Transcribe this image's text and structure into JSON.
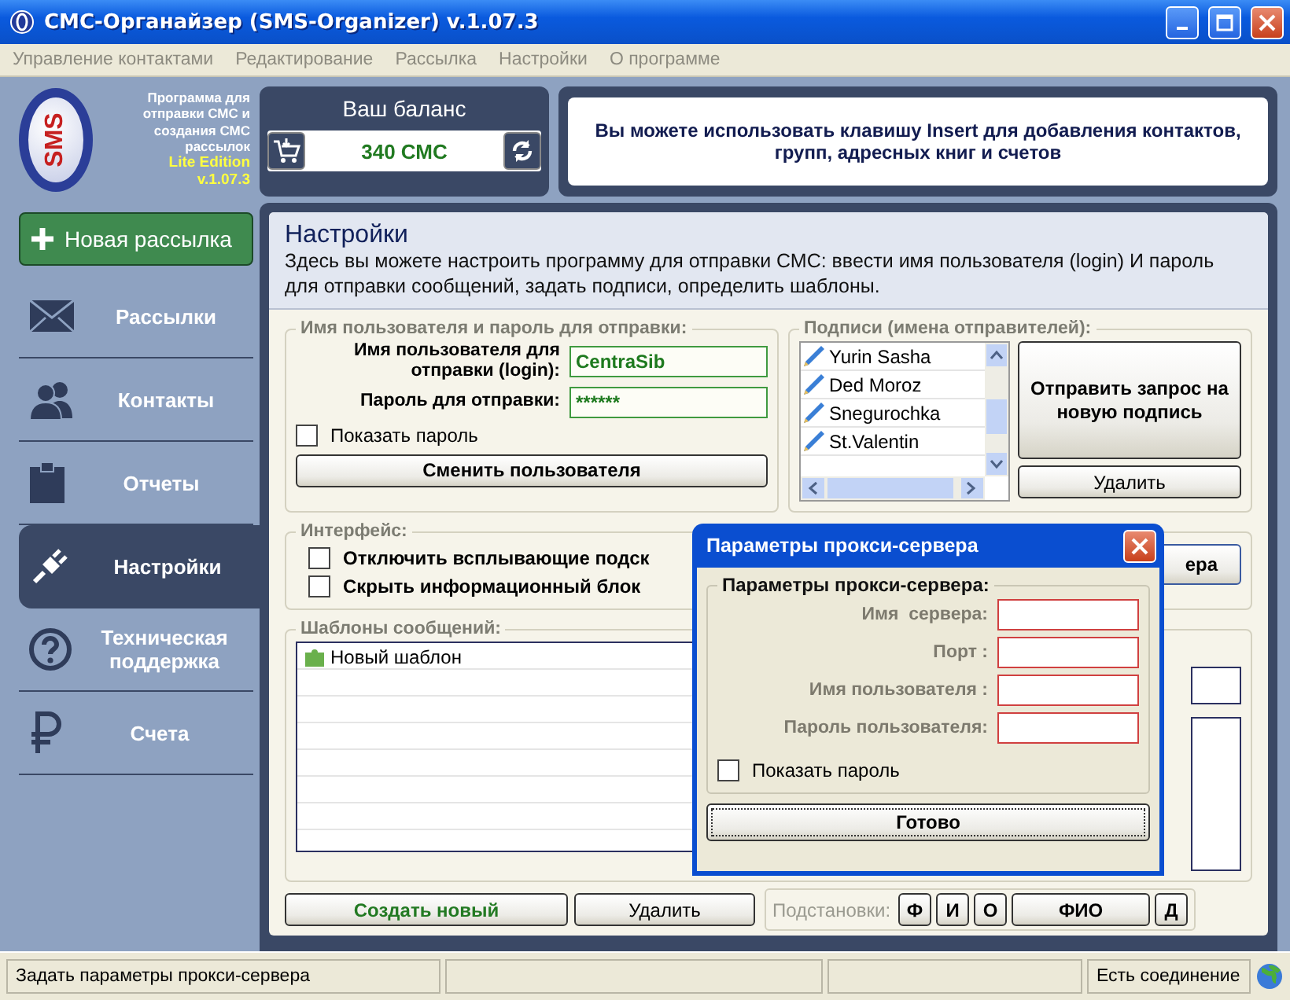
{
  "window": {
    "title": "СМС-Органайзер (SMS-Organizer) v.1.07.3"
  },
  "menu": [
    "Управление контактами",
    "Редактирование",
    "Рассылка",
    "Настройки",
    "О программе"
  ],
  "logo": {
    "mark": "SMS",
    "description": "Программа для отправки СМС и создания СМС рассылок",
    "edition": "Lite Edition",
    "version": "v.1.07.3"
  },
  "balance": {
    "title": "Ваш баланс",
    "value": "340 СМС"
  },
  "info": "Вы можете использовать клавишу Insert для добавления контактов, групп, адресных книг и счетов",
  "new_mailing": "Новая рассылка",
  "nav": [
    {
      "kind": "mail",
      "label": "Рассылки",
      "selected": false
    },
    {
      "kind": "contacts",
      "label": "Контакты",
      "selected": false
    },
    {
      "kind": "reports",
      "label": "Отчеты",
      "selected": false
    },
    {
      "kind": "settings",
      "label": "Настройки",
      "selected": true
    },
    {
      "kind": "support",
      "label": "Техническая поддержка",
      "selected": false
    },
    {
      "kind": "bills",
      "label": "Счета",
      "selected": false
    }
  ],
  "settings": {
    "title": "Настройки",
    "description": "Здесь вы можете настроить программу для отправки СМС: ввести имя пользователя (login) И пароль для отправки сообщений, задать подписи, определить шаблоны.",
    "credentials": {
      "legend": "Имя пользователя и пароль для отправки:",
      "login_label": "Имя пользователя для отправки (login):",
      "login": "CentraSib",
      "password_label": "Пароль для отправки:",
      "password": "******",
      "show_password": {
        "label": "Показать пароль",
        "checked": false
      },
      "change_button": "Сменить пользователя"
    },
    "signatures": {
      "legend": "Подписи (имена отправителей):",
      "items": [
        "Yurin Sasha",
        "Ded Moroz",
        "Snegurochka",
        "St.Valentin"
      ],
      "request_button": "Отправить запрос на новую подпись",
      "delete_button": "Удалить"
    },
    "interface": {
      "legend": "Интерфейс:",
      "options": [
        {
          "label": "Отключить всплывающие подск",
          "checked": false
        },
        {
          "label": "Скрыть информационный блок",
          "checked": false
        }
      ],
      "button": "ера"
    },
    "templates": {
      "legend": "Шаблоны сообщений:",
      "items": [
        "Новый шаблон"
      ],
      "create_button": "Создать новый",
      "delete_button": "Удалить",
      "substitutions_label": "Подстановки:",
      "substitutions": [
        "Ф",
        "И",
        "О",
        "ФИО",
        "Д"
      ]
    }
  },
  "proxy_dialog": {
    "title": "Параметры прокси-сервера",
    "legend": "Параметры прокси-сервера:",
    "fields": [
      "Имя  сервера:",
      "Порт :",
      "Имя пользователя :",
      "Пароль пользователя:"
    ],
    "show_password": {
      "label": "Показать пароль",
      "checked": false
    },
    "done_button": "Готово"
  },
  "status_bar": {
    "message": "Задать параметры прокси-сервера",
    "connection": "Есть соединение"
  }
}
